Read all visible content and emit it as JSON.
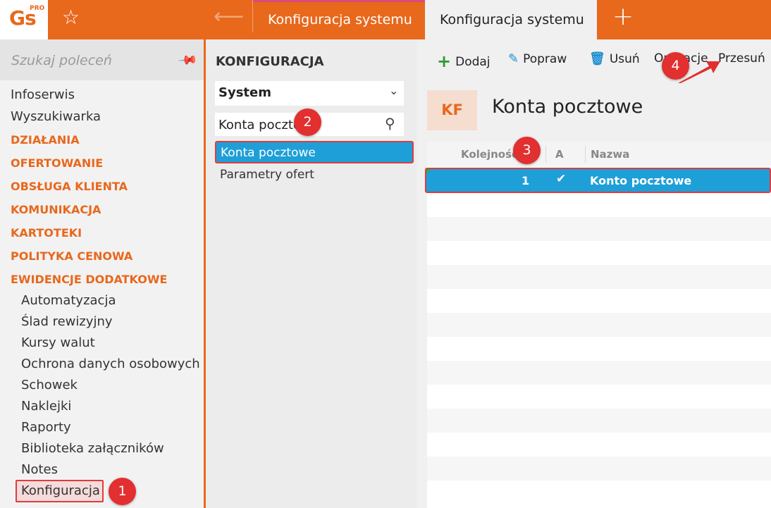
{
  "header": {
    "logo": "Gs",
    "logo_sup": "PRO",
    "tabs": [
      {
        "label": "Konfiguracja systemu"
      },
      {
        "label": "Konfiguracja systemu"
      }
    ]
  },
  "sidebar": {
    "search_placeholder": "Szukaj poleceń",
    "items": [
      {
        "label": "Infoserwis"
      },
      {
        "label": "Wyszukiwarka"
      },
      {
        "label": "DZIAŁANIA"
      },
      {
        "label": "OFERTOWANIE"
      },
      {
        "label": "OBSŁUGA KLIENTA"
      },
      {
        "label": "KOMUNIKACJA"
      },
      {
        "label": "KARTOTEKI"
      },
      {
        "label": "POLITYKA CENOWA"
      },
      {
        "label": "EWIDENCJE DODATKOWE"
      },
      {
        "label": "Automatyzacja"
      },
      {
        "label": "Ślad rewizyjny"
      },
      {
        "label": "Kursy walut"
      },
      {
        "label": "Ochrona danych osobowych"
      },
      {
        "label": "Schowek"
      },
      {
        "label": "Naklejki"
      },
      {
        "label": "Raporty"
      },
      {
        "label": "Biblioteka załączników"
      },
      {
        "label": "Notes"
      },
      {
        "label": "Konfiguracja"
      }
    ]
  },
  "middle": {
    "title": "KONFIGURACJA",
    "select_value": "System",
    "filter_value": "Konta pocztowe",
    "list": [
      {
        "label": "Konta pocztowe"
      },
      {
        "label": "Parametry ofert"
      }
    ]
  },
  "toolbar": {
    "add": "Dodaj",
    "edit": "Popraw",
    "delete": "Usuń",
    "operations": "Operacje",
    "move": "Przesuń"
  },
  "content": {
    "badge": "KF",
    "title": "Konta pocztowe",
    "columns": [
      "Kolejność",
      "A",
      "Nazwa"
    ],
    "rows": [
      {
        "order": "1",
        "active": "✔",
        "name": "Konto pocztowe"
      }
    ]
  },
  "badges": [
    "1",
    "2",
    "3",
    "4"
  ],
  "colors": {
    "accent": "#e8681c",
    "selection": "#1e9fd8",
    "highlight": "#e23b3b"
  }
}
